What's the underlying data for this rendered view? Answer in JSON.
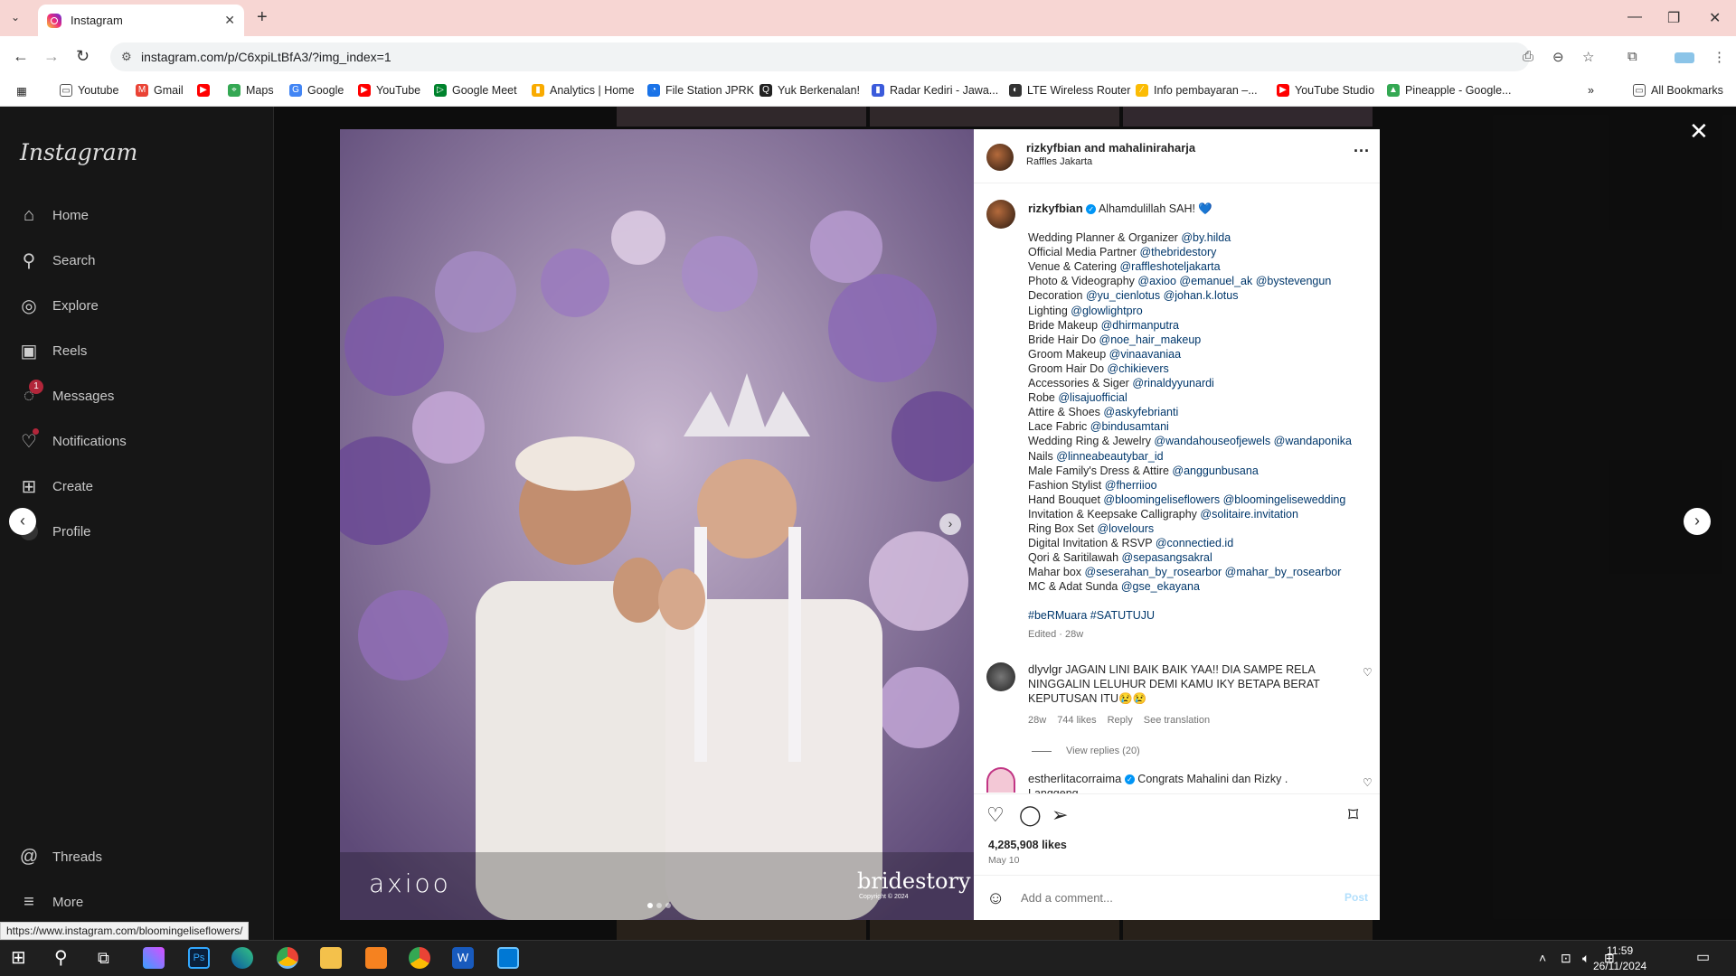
{
  "browser": {
    "tab_title": "Instagram",
    "url": "instagram.com/p/C6xpiLtBfA3/?img_index=1",
    "status_url": "https://www.instagram.com/bloomingeliseflowers/",
    "bookmarks": [
      "Youtube",
      "Gmail",
      "",
      "Maps",
      "Google",
      "YouTube",
      "Google Meet",
      "Analytics | Home",
      "File Station JPRK",
      "Yuk Berkenalan!",
      "Radar Kediri - Jawa...",
      "LTE Wireless Router",
      "Info pembayaran –...",
      "YouTube Studio",
      "Pineapple - Google..."
    ],
    "all_bookmarks": "All Bookmarks"
  },
  "sidebar": {
    "logo": "Instagram",
    "items": [
      "Home",
      "Search",
      "Explore",
      "Reels",
      "Messages",
      "Notifications",
      "Create",
      "Profile"
    ],
    "messages_badge": "1",
    "bottom": [
      "Threads",
      "More"
    ]
  },
  "post": {
    "header_user": "rizkyfbian and mahaliniraharja",
    "location": "Raffles Jakarta",
    "author": "rizkyfbian",
    "first_line": "Alhamdulillah SAH! 💙",
    "credits": [
      [
        "Wedding Planner & Organizer ",
        "@by.hilda"
      ],
      [
        "Official Media Partner ",
        "@thebridestory"
      ],
      [
        "Venue & Catering ",
        "@raffleshoteljakarta"
      ],
      [
        "Photo & Videography ",
        "@axioo @emanuel_ak @bystevengun"
      ],
      [
        "Decoration ",
        "@yu_cienlotus @johan.k.lotus"
      ],
      [
        "Lighting ",
        "@glowlightpro"
      ],
      [
        "Bride Makeup ",
        "@dhirmanputra"
      ],
      [
        "Bride Hair Do ",
        "@noe_hair_makeup"
      ],
      [
        "Groom Makeup ",
        "@vinaavaniaa"
      ],
      [
        "Groom Hair Do ",
        "@chikievers"
      ],
      [
        "Accessories & Siger ",
        "@rinaldyyunardi"
      ],
      [
        "Robe ",
        "@lisajuofficial"
      ],
      [
        "Attire & Shoes ",
        "@askyfebrianti"
      ],
      [
        "Lace Fabric ",
        "@bindusamtani"
      ],
      [
        "Wedding Ring & Jewelry ",
        "@wandahouseofjewels @wandaponika"
      ],
      [
        "Nails ",
        "@linneabeautybar_id"
      ],
      [
        "Male Family's Dress & Attire ",
        "@anggunbusana"
      ],
      [
        "Fashion Stylist ",
        "@fherriioo"
      ],
      [
        "Hand Bouquet ",
        "@bloomingeliseflowers @bloomingelisewedding"
      ],
      [
        "Invitation & Keepsake Calligraphy ",
        "@solitaire.invitation"
      ],
      [
        "Ring Box Set ",
        "@lovelours"
      ],
      [
        "Digital Invitation & RSVP ",
        "@connectied.id"
      ],
      [
        "Qori & Saritilawah ",
        "@sepasangsakral"
      ],
      [
        "Mahar box ",
        "@seserahan_by_rosearbor @mahar_by_rosearbor"
      ],
      [
        "MC & Adat Sunda ",
        "@gse_ekayana"
      ]
    ],
    "hashtags": "#beRMuara #SATUTUJU",
    "edited": "Edited · 28w",
    "comment1": {
      "user": "dlyvlgr",
      "text": "JAGAIN LINI BAIK BAIK YAA!! DIA SAMPE RELA NINGGALIN LELUHUR DEMI KAMU IKY BETAPA BERAT KEPUTUSAN ITU😢😢",
      "time": "28w",
      "likes": "744 likes",
      "reply": "Reply",
      "translate": "See translation",
      "view_replies": "View replies (20)"
    },
    "comment2": {
      "user": "estherlitacorraima",
      "text": "Congrats Mahalini dan Rizky . Langgeng"
    },
    "likes": "4,285,908 likes",
    "date": "May 10",
    "add_comment_placeholder": "Add a comment...",
    "post_button": "Post",
    "watermark_left": "axioo",
    "watermark_right": "bridestory",
    "watermark_copy": "Copyright © 2024"
  },
  "taskbar": {
    "time": "11:59",
    "date": "26/11/2024"
  }
}
